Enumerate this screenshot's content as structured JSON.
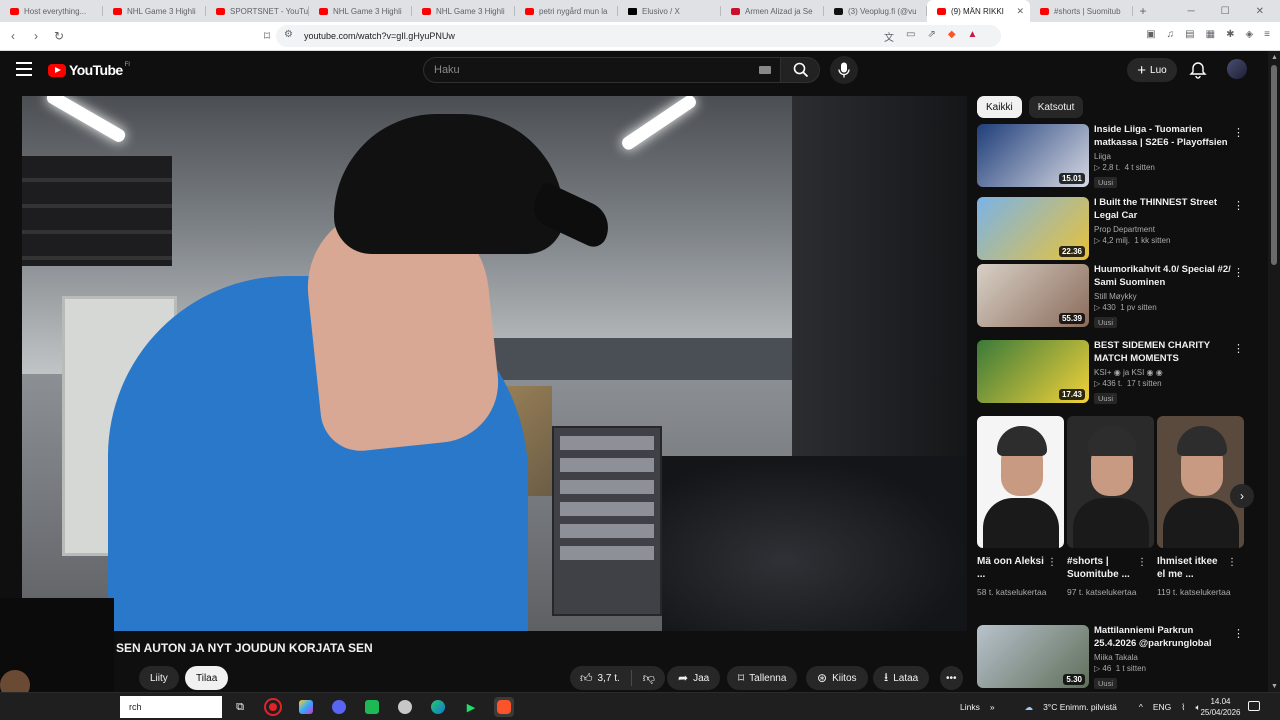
{
  "browser": {
    "tabs": [
      {
        "label": "Host everything...",
        "icon": "youtube-icon"
      },
      {
        "label": "NHL Game 3 Highli",
        "icon": "youtube-icon"
      },
      {
        "label": "SPORTSNET - YouTu",
        "icon": "youtube-icon"
      },
      {
        "label": "NHL Game 3 Highli",
        "icon": "youtube-icon"
      },
      {
        "label": "NHL Game 3 Highli",
        "icon": "youtube-icon"
      },
      {
        "label": "petri nygård mun la",
        "icon": "youtube-icon"
      },
      {
        "label": "Elusivo / X",
        "icon": "x-icon"
      },
      {
        "label": "Armen Alizad ja Se",
        "icon": "news-icon"
      },
      {
        "label": "(3) Veoplug.fi (@vu",
        "icon": "tiktok-icon"
      },
      {
        "label": "(9) MÄN RIKKI",
        "icon": "youtube-icon",
        "active": true
      },
      {
        "label": "#shorts | Suomitub",
        "icon": "youtube-icon"
      }
    ],
    "new_tab": "+",
    "url": "youtube.com/watch?v=gIl.gHyuPNUw"
  },
  "masthead": {
    "logo_text": "YouTube",
    "country_code": "FI",
    "search_placeholder": "Haku",
    "create_label": "Luo"
  },
  "video": {
    "title": "SEN AUTON JA NYT JOUDUN KORJATA SEN",
    "join_label": "Liity",
    "subscribe_label": "Tilaa",
    "likes": "3,7 t.",
    "share_label": "Jaa",
    "save_label": "Tallenna",
    "thanks_label": "Kiitos",
    "download_label": "Lataa"
  },
  "sidebar": {
    "chips": [
      {
        "label": "Kaikki",
        "selected": true
      },
      {
        "label": "Katsotut",
        "selected": false
      }
    ],
    "recommendations": [
      {
        "title": "Inside Liiga - Tuomarien matkassa | S2E6 - Playoffsien ...",
        "channel": "Liiga",
        "views": "▷ 2,8 t.",
        "age": "4 t sitten",
        "badge": "Uusi",
        "duration": "15.01",
        "thumb_colors": [
          "#1f3e7a",
          "#d7d9e3"
        ]
      },
      {
        "title": "I Built the THINNEST Street Legal Car",
        "channel": "Prop Department",
        "views": "▷ 4,2 milj.",
        "age": "1 kk sitten",
        "badge": "",
        "duration": "22.36",
        "thumb_colors": [
          "#7ab3e8",
          "#e8c23a"
        ]
      },
      {
        "title": "Huumorikahvit 4.0/ Special #2/ Sami Suominen",
        "channel": "Still Møykky",
        "views": "▷ 430",
        "age": "1 pv sitten",
        "badge": "Uusi",
        "duration": "55.39",
        "thumb_colors": [
          "#d8d0c6",
          "#8a6b5a"
        ]
      },
      {
        "title": "BEST SIDEMEN CHARITY MATCH MOMENTS",
        "channel": "KSI+ ◉ ja KSI ◉ ◉",
        "views": "▷ 436 t.",
        "age": "17 t sitten",
        "badge": "Uusi",
        "duration": "17.43",
        "thumb_colors": [
          "#3a7a3a",
          "#f2d23a"
        ]
      },
      {
        "title": "Mattilanniemi Parkrun 25.4.2026 @parkrunglobal",
        "channel": "Miika Takala",
        "views": "▷ 46",
        "age": "1 t sitten",
        "badge": "Uusi",
        "duration": "5.30",
        "thumb_colors": [
          "#b8c2cc",
          "#5f6f5a"
        ]
      }
    ],
    "shorts": [
      {
        "title": "Mä oon Aleksi ...",
        "views": "58 t. katselukertaa",
        "bg": "#f5f5f5"
      },
      {
        "title": "#shorts | Suomitube ...",
        "views": "97 t. katselukertaa",
        "bg": "#2a2a2a"
      },
      {
        "title": "Ihmiset itkee el me ...",
        "views": "119 t. katselukertaa",
        "bg": "#5a4a3e"
      }
    ]
  },
  "taskbar": {
    "search_text": "rch",
    "links_label": "Links",
    "weather": "3°C  Enimm. pilvistä",
    "language": "ENG",
    "time": "14.04",
    "date": "25/04/2026"
  }
}
